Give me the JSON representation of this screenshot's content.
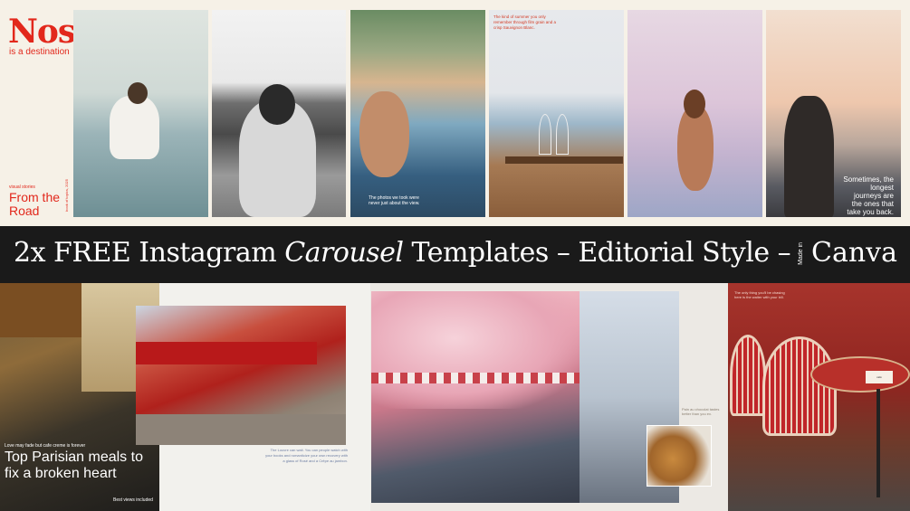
{
  "top": {
    "brand_title": "Nostalgia",
    "brand_subtitle": "is a destination",
    "visual_stories": "visual stories",
    "from_the_road": "From the Road",
    "vertical_note": "book of topics, 2025",
    "panel3_caption": "The photos we took were never just about the view.",
    "panel4_caption": "The kind of summer you only remember through film grain and a crisp Sauvignon Blanc.",
    "panel6_caption": "Sometimes, the longest journeys are the ones that take you back."
  },
  "banner": {
    "lead": "2x FREE Instagram ",
    "italic": "Carousel",
    "trail": " Templates  –  Editorial Style  – ",
    "made_in": "Made in",
    "canva": "Canva"
  },
  "bottom": {
    "b1_small": "Love may fade but cafe creme is forever",
    "b1_title": "Top Parisian meals to fix a broken heart",
    "b1_foot": "Best views included",
    "b2_caption": "The Louvre can wait. You can people watch with your books and romanticize your own recovery with a glass of Rosé and a Crêpe au jambon.",
    "b3_caption": "Pain au chocolat tastes better than you ex.",
    "b4_caption": "The only thing you'll be chasing here is the waiter with your bill.",
    "b4_card": "café"
  },
  "colors": {
    "brand_red": "#e2281c",
    "cream": "#f6f1e7",
    "banner_bg": "#1a1a1a"
  }
}
